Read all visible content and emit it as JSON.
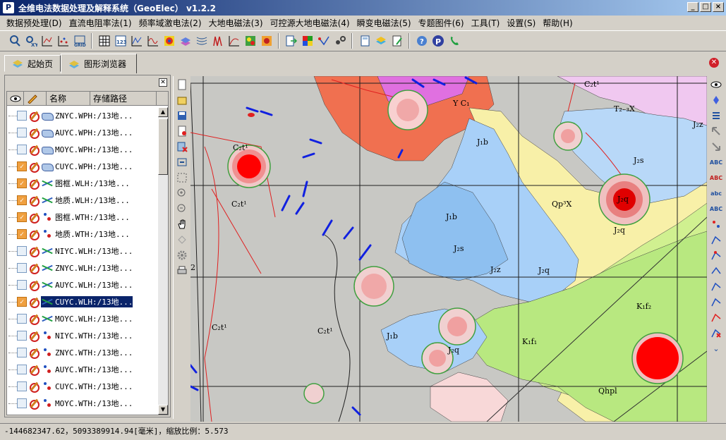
{
  "window": {
    "title": "全维电法数据处理及解释系统（GeoElec） v1.2.2",
    "icon_letter": "P"
  },
  "menu": [
    "数据预处理(D)",
    "直流电阻率法(1)",
    "频率域激电法(2)",
    "大地电磁法(3)",
    "可控源大地电磁法(4)",
    "瞬变电磁法(5)",
    "专题图件(6)",
    "工具(T)",
    "设置(S)",
    "帮助(H)"
  ],
  "toolbar": [
    "zoom-point-tool-icon",
    "xyz-tool-icon",
    "contour-tool-icon",
    "scatter-tool-icon",
    "grid-tool-icon",
    "table-icon",
    "data-123-icon",
    "line-chart-icon",
    "wave-chart-icon",
    "color-map-icon",
    "layers-icon",
    "section-icon",
    "profile-icon",
    "curve-icon",
    "map-color-icon",
    "map-grid-icon",
    "export-icon",
    "palette-icon",
    "vector-icon",
    "points-icon",
    "calculator-icon",
    "stack-icon",
    "edit-doc-icon",
    "help-icon",
    "p-logo-icon",
    "phone-icon"
  ],
  "tabs": [
    {
      "label": "起始页",
      "active": false
    },
    {
      "label": "图形浏览器",
      "active": true
    }
  ],
  "layer_panel": {
    "headers": {
      "visible": "",
      "edit": "",
      "name": "名称",
      "path": "存储路径"
    },
    "rows": [
      {
        "type": "poly",
        "checked": false,
        "name": "ZNYC.WP",
        "path": "H:/13地..."
      },
      {
        "type": "poly",
        "checked": false,
        "name": "AUYC.WP",
        "path": "H:/13地..."
      },
      {
        "type": "poly",
        "checked": false,
        "name": "MOYC.WP",
        "path": "H:/13地..."
      },
      {
        "type": "poly",
        "checked": true,
        "name": "CUYC.WP",
        "path": "H:/13地..."
      },
      {
        "type": "line",
        "checked": true,
        "name": "图框.WL",
        "path": "H:/13地..."
      },
      {
        "type": "line",
        "checked": true,
        "name": "地质.WL",
        "path": "H:/13地..."
      },
      {
        "type": "pt",
        "checked": true,
        "name": "图框.WT",
        "path": "H:/13地..."
      },
      {
        "type": "pt",
        "checked": true,
        "name": "地质.WT",
        "path": "H:/13地..."
      },
      {
        "type": "line",
        "checked": false,
        "name": "NIYC.WL",
        "path": "H:/13地..."
      },
      {
        "type": "line",
        "checked": false,
        "name": "ZNYC.WL",
        "path": "H:/13地..."
      },
      {
        "type": "line",
        "checked": false,
        "name": "AUYC.WL",
        "path": "H:/13地..."
      },
      {
        "type": "line",
        "checked": true,
        "name": "CUYC.WL",
        "path": "H:/13地...",
        "selected": true
      },
      {
        "type": "line",
        "checked": false,
        "name": "MOYC.WL",
        "path": "H:/13地..."
      },
      {
        "type": "pt",
        "checked": false,
        "name": "NIYC.WT",
        "path": "H:/13地..."
      },
      {
        "type": "pt",
        "checked": false,
        "name": "ZNYC.WT",
        "path": "H:/13地..."
      },
      {
        "type": "pt",
        "checked": false,
        "name": "AUYC.WT",
        "path": "H:/13地..."
      },
      {
        "type": "pt",
        "checked": false,
        "name": "CUYC.WT",
        "path": "H:/13地..."
      },
      {
        "type": "pt",
        "checked": false,
        "name": "MOYC.WT",
        "path": "H:/13地..."
      }
    ]
  },
  "map_labels": {
    "c2t1_a": "C₂t¹",
    "c2t1_b": "C₂t¹",
    "c2t1_c": "C₂t¹",
    "c2t1_d": "C₂t¹",
    "c2t1_e": "C₂t¹",
    "yc1": "Y C₁",
    "t2x": "T₂₋₃X",
    "j1b_a": "J₁b",
    "j1b_b": "J₁b",
    "j1b_c": "J₁b",
    "j2s_a": "J₂s",
    "j2s_b": "J₂s",
    "j2z_a": "J₂z",
    "j2z_b": "J₂z",
    "j2q_a": "J₂q",
    "j2q_b": "J₂q",
    "j2q_c": "J₂q",
    "j2q_d": "J₂q",
    "qpx": "Qp³X",
    "k1f2": "K₁f₂",
    "k1f1": "K₁f₁",
    "qhpl": "Qhpl",
    "num2": "2"
  },
  "status": "-144682347.62，5093389914.94[毫米]，缩放比例：5.573",
  "colors": {
    "title_start": "#0a246a",
    "title_end": "#a6caf0",
    "anomaly_red": "#ff0000",
    "selection": "#0a246a"
  }
}
